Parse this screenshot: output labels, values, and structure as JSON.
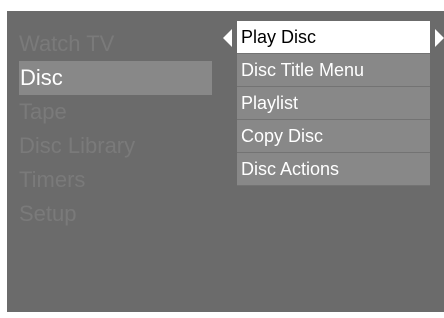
{
  "main_menu": {
    "items": [
      {
        "label": "Watch TV"
      },
      {
        "label": "Disc"
      },
      {
        "label": "Tape"
      },
      {
        "label": "Disc Library"
      },
      {
        "label": "Timers"
      },
      {
        "label": "Setup"
      }
    ],
    "active_label": "Disc"
  },
  "sub_menu": {
    "items": [
      {
        "label": "Play Disc"
      },
      {
        "label": "Disc Title Menu"
      },
      {
        "label": "Playlist"
      },
      {
        "label": "Copy Disc"
      },
      {
        "label": "Disc Actions"
      }
    ],
    "selected_label": "Play Disc"
  },
  "icons": {
    "left": "chevron-left-icon",
    "right": "chevron-right-icon"
  },
  "colors": {
    "screen_bg": "#6b6b6b",
    "highlight_bg": "#888888",
    "selected_bg": "#ffffff",
    "dim_text": "#7a7a7a"
  }
}
